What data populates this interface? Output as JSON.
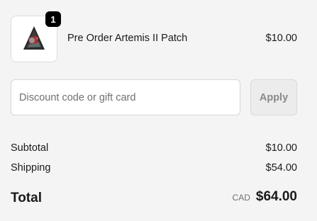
{
  "line_item": {
    "quantity": "1",
    "title": "Pre Order Artemis II Patch",
    "price": "$10.00",
    "image_icon": "artemis-patch-icon"
  },
  "discount": {
    "placeholder": "Discount code or gift card",
    "value": "",
    "apply_label": "Apply"
  },
  "summary": {
    "subtotal_label": "Subtotal",
    "subtotal_value": "$10.00",
    "shipping_label": "Shipping",
    "shipping_value": "$54.00",
    "total_label": "Total",
    "currency": "CAD",
    "total_value": "$64.00"
  },
  "colors": {
    "background": "#f4f4f4",
    "badge": "#000000",
    "apply_button_bg": "#ececec"
  }
}
